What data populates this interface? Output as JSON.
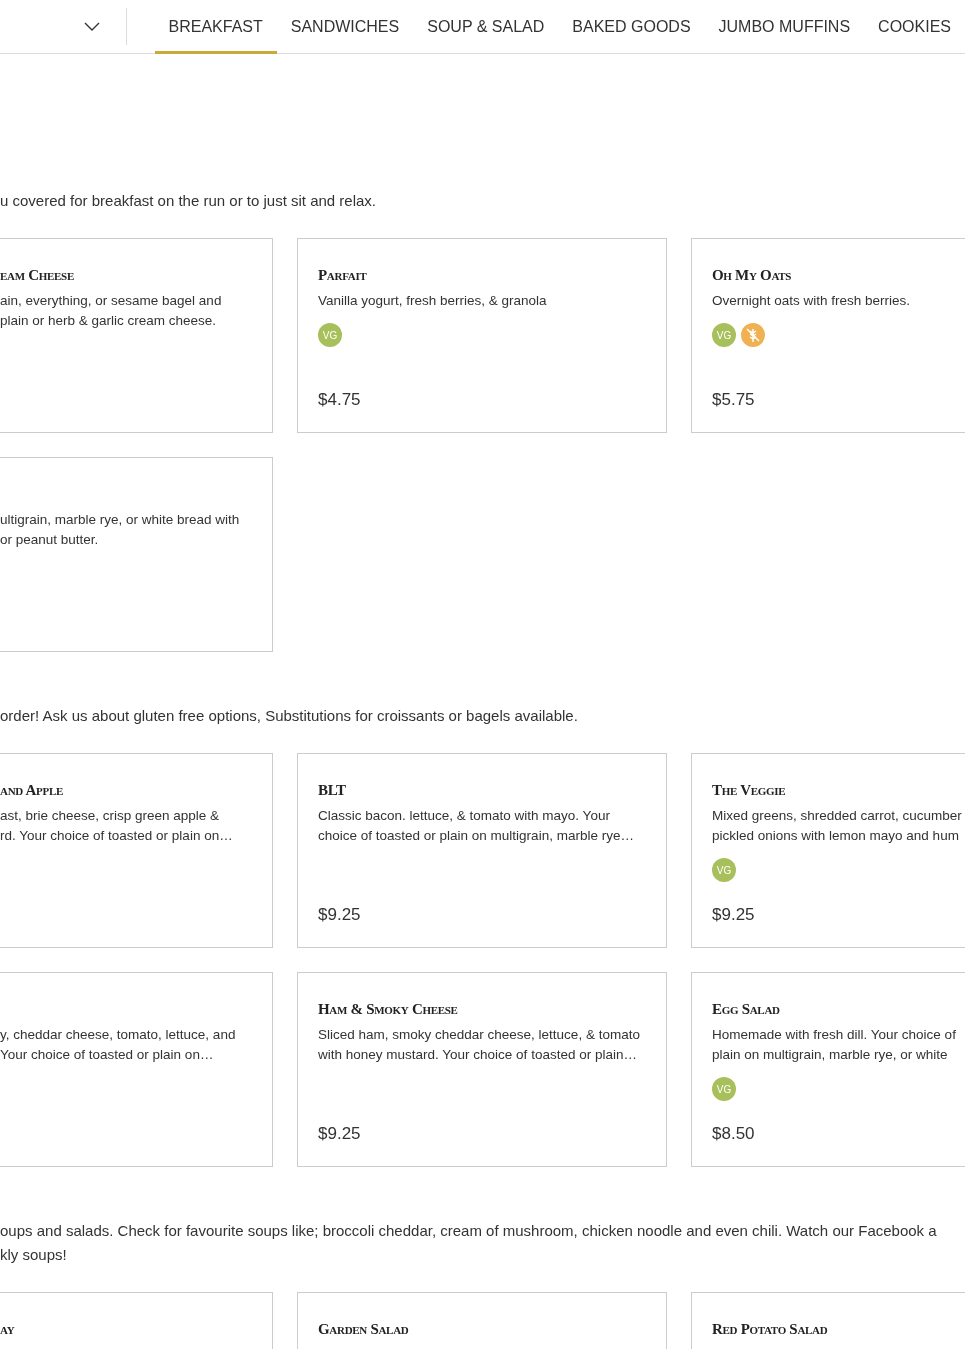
{
  "nav": {
    "tabs": [
      {
        "label": "BREAKFAST",
        "selected": true
      },
      {
        "label": "SANDWICHES",
        "selected": false
      },
      {
        "label": "SOUP & SALAD",
        "selected": false
      },
      {
        "label": "BAKED GOODS",
        "selected": false
      },
      {
        "label": "JUMBO MUFFINS",
        "selected": false
      },
      {
        "label": "COOKIES",
        "selected": false
      }
    ]
  },
  "sections": [
    {
      "intro": "u covered for breakfast on the run or to just sit and relax.",
      "items": [
        {
          "title": "eam Cheese",
          "description": "ain, everything, or sesame bagel and\nplain or herb & garlic cream cheese."
        },
        {
          "title": "Parfait",
          "description": "Vanilla yogurt, fresh berries, & granola",
          "badges": [
            {
              "kind": "vegetarian",
              "label": "VG"
            }
          ],
          "price": "$4.75"
        },
        {
          "title": "Oh My Oats",
          "description": "Overnight oats with fresh berries.",
          "badges": [
            {
              "kind": "vegetarian",
              "label": "VG"
            },
            {
              "kind": "gluten_free"
            }
          ],
          "price": "$5.75"
        },
        {
          "description": "ultigrain, marble rye, or white bread with\nor peanut butter."
        }
      ]
    },
    {
      "intro": "order! Ask us about gluten free options, Substitutions for croissants or bagels available.",
      "items": [
        {
          "title": "and Apple",
          "description": "ast, brie cheese, crisp green apple &\nrd. Your choice of toasted or plain on…"
        },
        {
          "title": "BLT",
          "description": "Classic bacon. lettuce, & tomato with mayo. Your\nchoice of toasted or plain on multigrain, marble rye…",
          "price": "$9.25"
        },
        {
          "title": "The Veggie",
          "description": "Mixed greens, shredded carrot, cucumber\npickled onions with lemon mayo and hum",
          "badges": [
            {
              "kind": "vegetarian",
              "label": "VG"
            }
          ],
          "price": "$9.25"
        },
        {
          "description": "y, cheddar cheese, tomato, lettuce, and\nYour choice of toasted or plain on…"
        },
        {
          "title": "Ham & Smoky Cheese",
          "description": "Sliced ham, smoky cheddar cheese, lettuce, & tomato\nwith honey mustard. Your choice of toasted or plain…",
          "price": "$9.25"
        },
        {
          "title": "Egg Salad",
          "description": "Homemade with fresh dill. Your choice of\nplain on multigrain, marble rye, or white",
          "badges": [
            {
              "kind": "vegetarian",
              "label": "VG"
            }
          ],
          "price": "$8.50"
        }
      ]
    },
    {
      "intro": "oups and salads. Check for favourite soups like; broccoli cheddar, cream of mushroom, chicken noodle and even chili. Watch our Facebook a\nkly soups!",
      "items": [
        {
          "title": "ay"
        },
        {
          "title": "Garden Salad"
        },
        {
          "title": "Red Potato Salad"
        }
      ]
    }
  ]
}
